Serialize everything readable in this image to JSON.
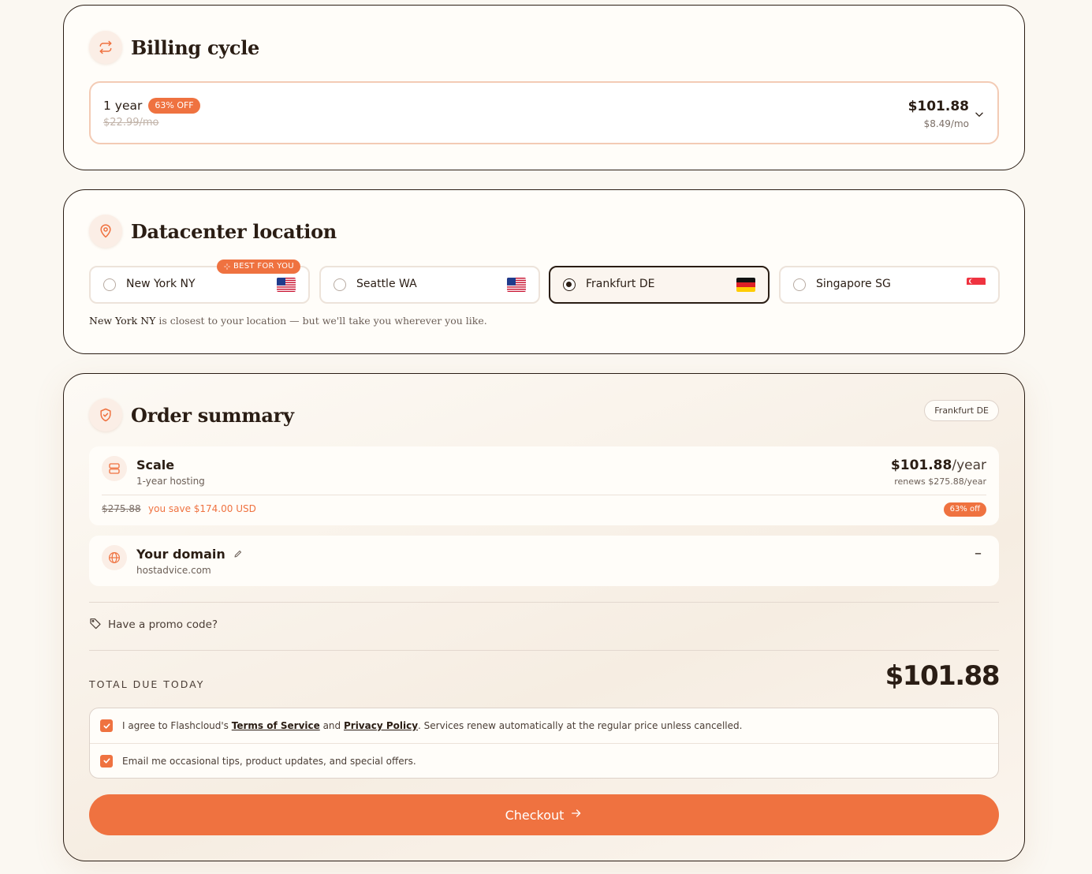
{
  "billing": {
    "title": "Billing cycle",
    "term": "1 year",
    "discount_badge": "63% OFF",
    "original_price": "$22.99/mo",
    "price": "$101.88",
    "monthly_price": "$8.49/mo"
  },
  "datacenter": {
    "title": "Datacenter location",
    "best_badge": "BEST FOR YOU",
    "locations": [
      {
        "label": "New York NY",
        "flag": "us-flag"
      },
      {
        "label": "Seattle WA",
        "flag": "us-flag"
      },
      {
        "label": "Frankfurt DE",
        "flag": "de-flag",
        "selected": true
      },
      {
        "label": "Singapore SG",
        "flag": "sg-flag"
      }
    ],
    "note_location": "New York NY",
    "note_text": " is closest to your location — but we'll take you wherever you like."
  },
  "summary": {
    "title": "Order summary",
    "location_tag": "Frankfurt DE",
    "plan": {
      "name": "Scale",
      "subtitle": "1-year hosting",
      "price": "$101.88",
      "per": "/year",
      "renews": "renews $275.88/year",
      "original": "$275.88",
      "savings": "you save $174.00 USD",
      "discount": "63% off"
    },
    "domain": {
      "name": "Your domain",
      "value": "hostadvice.com",
      "minus": "–"
    },
    "promo_label": "Have a promo code?",
    "total_label": "TOTAL DUE TODAY",
    "total_value": "$101.88",
    "terms": {
      "prefix": "I agree to Flashcloud's ",
      "tos": "Terms of Service",
      "and": " and ",
      "privacy": "Privacy Policy",
      "suffix": ". Services renew automatically at the regular price unless cancelled."
    },
    "marketing": "Email me occasional tips, product updates, and special offers.",
    "checkout_label": "Checkout"
  },
  "colors": {
    "accent": "#ef7240",
    "ink": "#2a1d14",
    "background": "#fbf8f2"
  }
}
